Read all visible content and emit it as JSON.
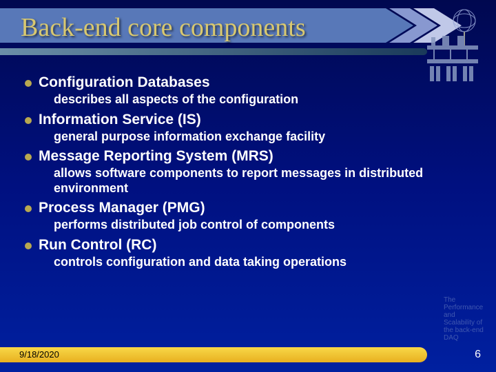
{
  "title": "Back-end core components",
  "items": [
    {
      "heading": "Configuration Databases",
      "desc": "describes all aspects of the configuration"
    },
    {
      "heading": "Information Service (IS)",
      "desc": "general purpose information exchange facility"
    },
    {
      "heading": "Message Reporting System (MRS)",
      "desc": "allows software components to report messages in distributed environment"
    },
    {
      "heading": "Process Manager (PMG)",
      "desc": "performs distributed job control of components"
    },
    {
      "heading": "Run Control (RC)",
      "desc": "controls configuration and data taking operations"
    }
  ],
  "watermark": "The Performance and Scalability of the back-end DAQ",
  "footer": {
    "date": "9/18/2020",
    "slide_number": "6"
  }
}
